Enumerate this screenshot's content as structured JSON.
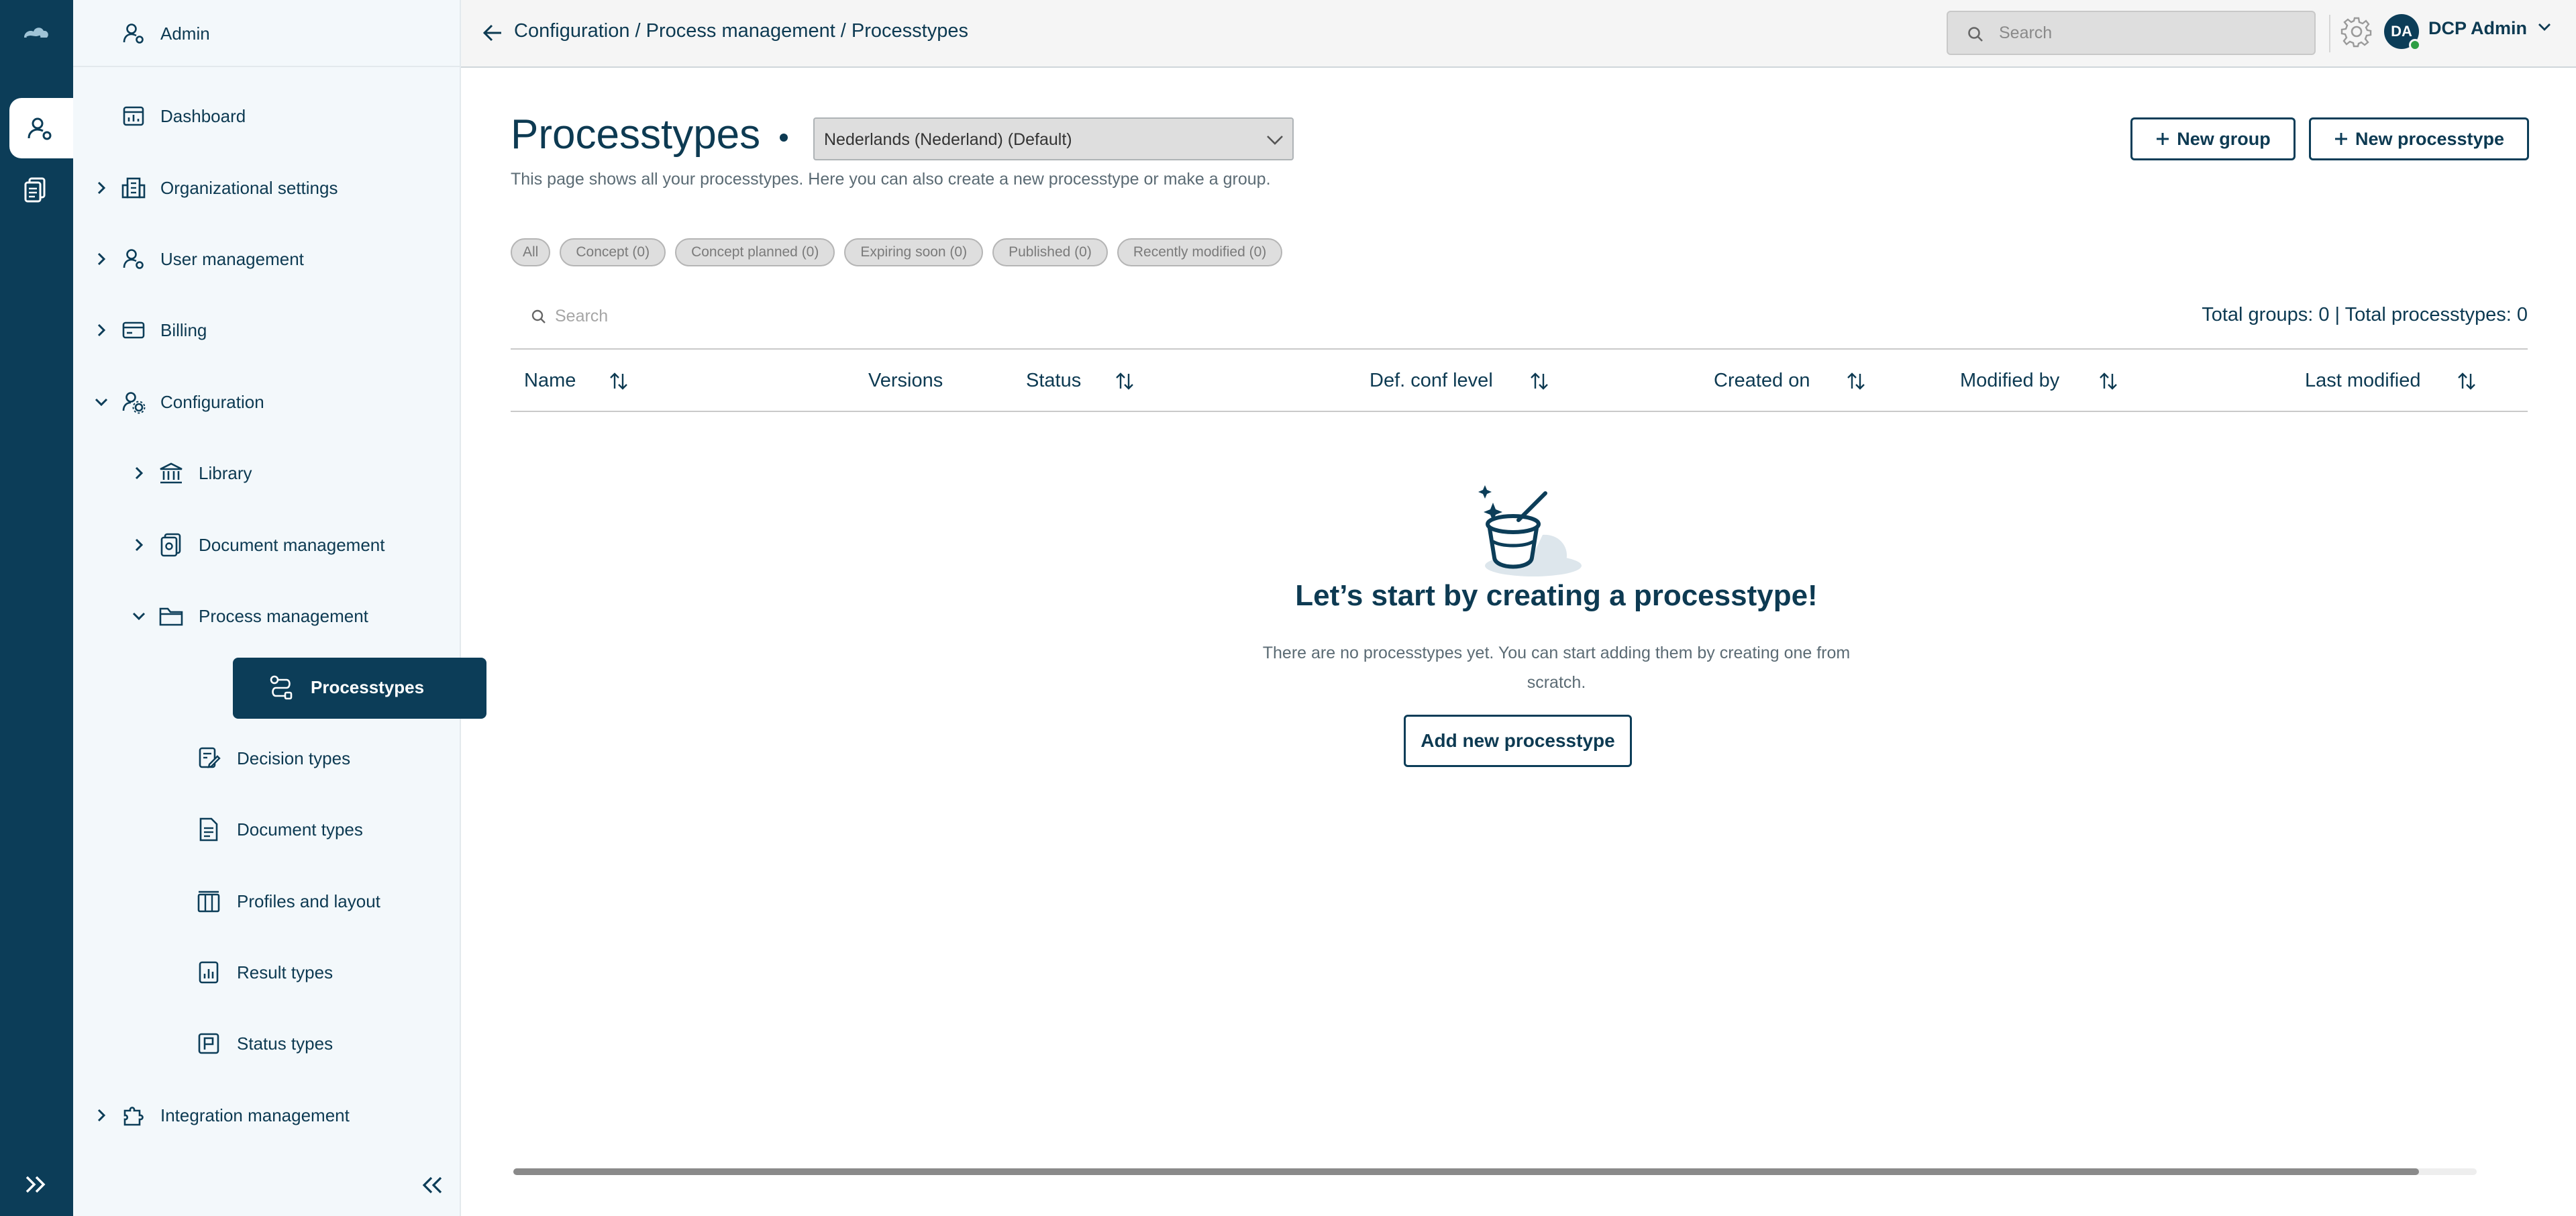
{
  "sidebar": {
    "header_label": "Admin",
    "items": [
      {
        "label": "Dashboard"
      },
      {
        "label": "Organizational settings"
      },
      {
        "label": "User management"
      },
      {
        "label": "Billing"
      },
      {
        "label": "Configuration"
      },
      {
        "label": "Library"
      },
      {
        "label": "Document management"
      },
      {
        "label": "Process management"
      },
      {
        "label": "Processtypes"
      },
      {
        "label": "Decision types"
      },
      {
        "label": "Document types"
      },
      {
        "label": "Profiles and layout"
      },
      {
        "label": "Result types"
      },
      {
        "label": "Status types"
      },
      {
        "label": "Integration management"
      }
    ]
  },
  "topbar": {
    "breadcrumb": "Configuration / Process management / Processtypes",
    "search_placeholder": "Search",
    "avatar_initials": "DA",
    "user_name": "DCP Admin"
  },
  "page": {
    "title": "Processtypes",
    "language_selected": "Nederlands (Nederland) (Default)",
    "new_group_label": "New group",
    "new_processtype_label": "New processtype",
    "description": "This page shows all your processtypes. Here you can also create a new processtype or make a group.",
    "filters": [
      "All",
      "Concept (0)",
      "Concept planned (0)",
      "Expiring soon (0)",
      "Published (0)",
      "Recently modified (0)"
    ],
    "table_search_placeholder": "Search",
    "totals": "Total groups: 0 | Total processtypes: 0",
    "columns": [
      "Name",
      "Versions",
      "Status",
      "Def. conf level",
      "Created on",
      "Modified by",
      "Last modified"
    ],
    "empty_title": "Let’s start by creating a processtype!",
    "empty_text": "There are no processtypes yet. You can start adding them by creating one from scratch.",
    "add_button": "Add new processtype"
  },
  "colors": {
    "brand_dark": "#0c3d58",
    "sidebar_bg": "#f3f8fb",
    "status_online": "#2e9e44"
  }
}
